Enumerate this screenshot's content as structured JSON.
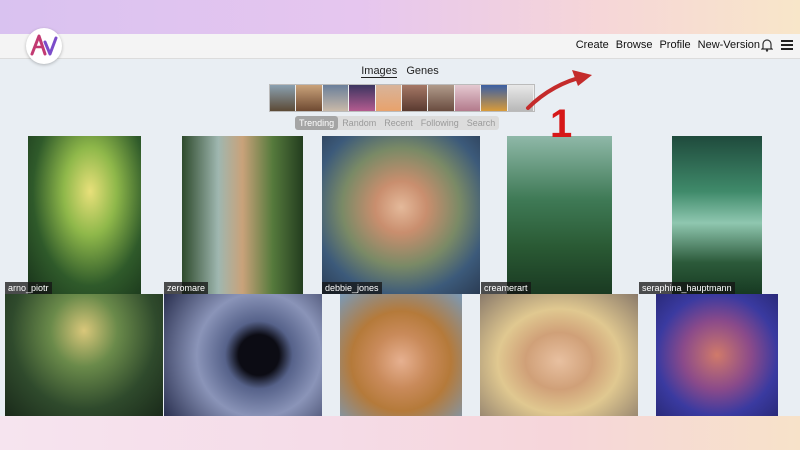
{
  "nav": {
    "links": [
      "Create",
      "Browse",
      "Profile",
      "New-Version"
    ],
    "bell_icon": "bell-icon",
    "menu_icon": "hamburger-menu-icon"
  },
  "tabs": {
    "images": "Images",
    "genes": "Genes"
  },
  "filters": [
    "Trending",
    "Random",
    "Recent",
    "Following",
    "Search"
  ],
  "gallery": {
    "row1": [
      "arno_piotr",
      "zeromare",
      "debbie_jones",
      "creamerart",
      "seraphina_hauptmann"
    ]
  },
  "annotation": {
    "step": "1",
    "color": "#d61818"
  },
  "colors": {
    "accent": "#c23a72",
    "arrow": "#c42b2b"
  }
}
